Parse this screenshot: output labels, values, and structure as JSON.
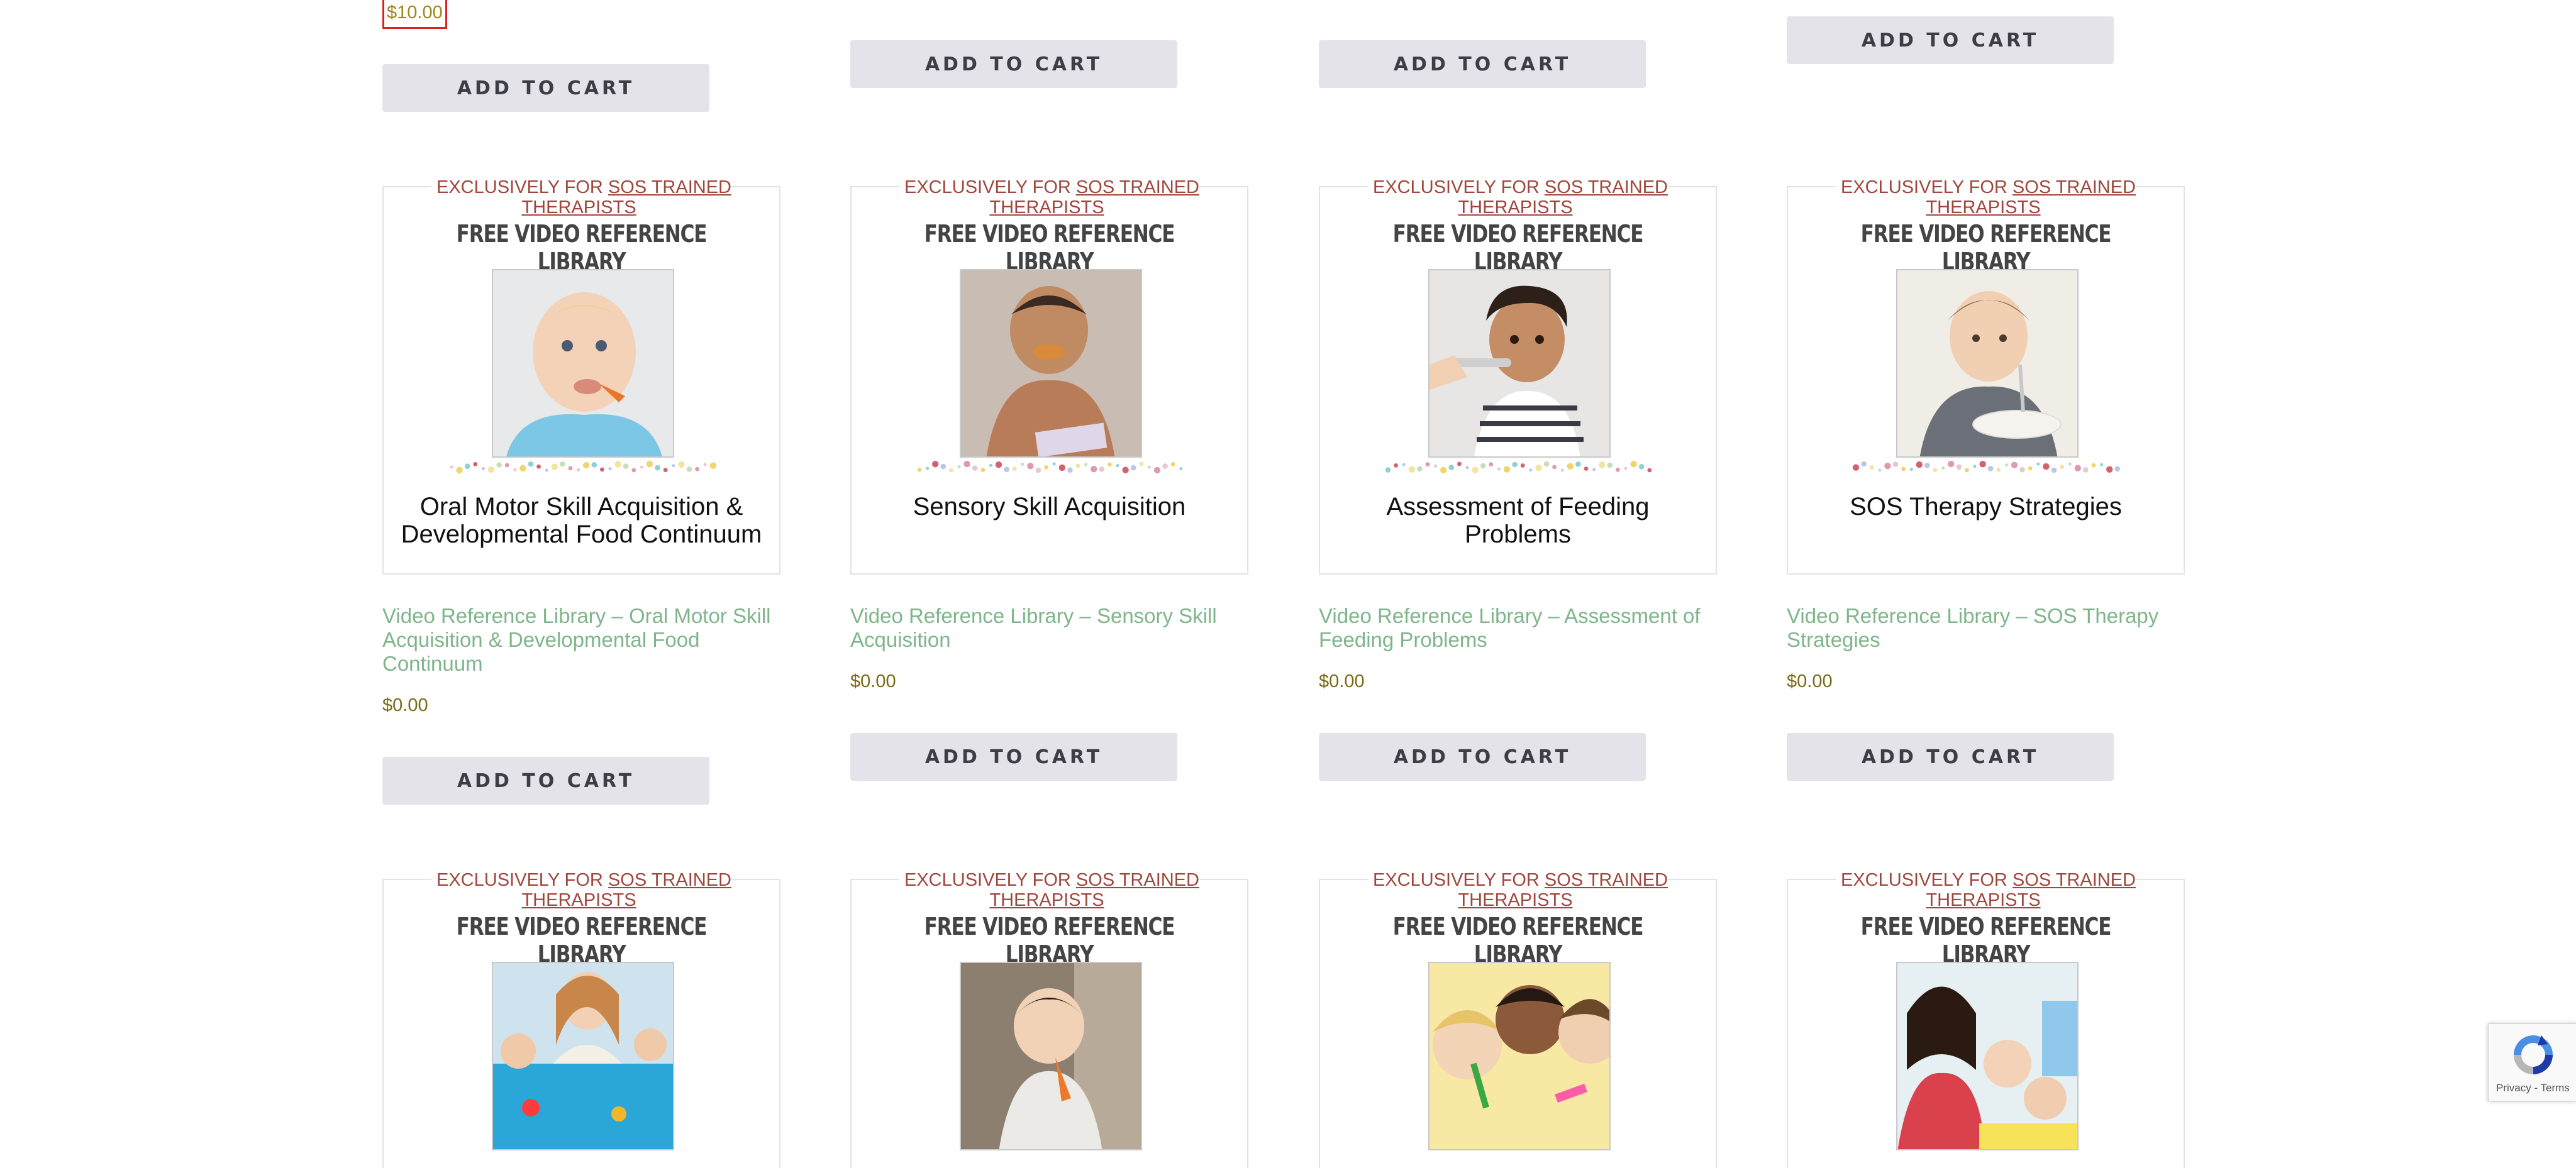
{
  "top_row": {
    "price_first": "$10.00",
    "button_label": "ADD TO CART"
  },
  "card_common": {
    "exclusive_prefix": "EXCLUSIVELY FOR",
    "exclusive_link": "SOS TRAINED THERAPISTS",
    "banner": "FREE VIDEO REFERENCE LIBRARY"
  },
  "products": [
    {
      "card_title": "Oral Motor Skill Acquisition & Developmental Food Continuum",
      "link": "Video Reference Library – Oral Motor Skill Acquisition & Developmental Food Continuum",
      "price": "$0.00",
      "button": "ADD TO CART"
    },
    {
      "card_title": "Sensory Skill Acquisition",
      "link": "Video Reference Library – Sensory Skill Acquisition",
      "price": "$0.00",
      "button": "ADD TO CART"
    },
    {
      "card_title": "Assessment of Feeding Problems",
      "link": "Video Reference Library – Assessment of Feeding Problems",
      "price": "$0.00",
      "button": "ADD TO CART"
    },
    {
      "card_title": "SOS Therapy Strategies",
      "link": "Video Reference Library – SOS Therapy Strategies",
      "price": "$0.00",
      "button": "ADD TO CART"
    }
  ],
  "recaptcha": {
    "terms": "Privacy - Terms"
  },
  "colors": {
    "button_bg": "#e5e3ea",
    "link_green": "#7fb58b",
    "exclusive_red": "#a0463c",
    "price_gold": "#7a6a17"
  }
}
